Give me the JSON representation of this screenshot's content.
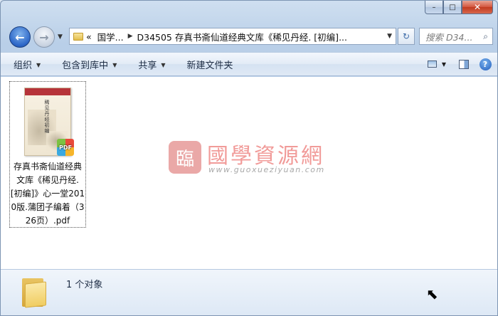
{
  "window": {
    "caption": {
      "minimize": "–",
      "maximize": "□",
      "close": "✕"
    }
  },
  "nav": {
    "back_icon": "←",
    "forward_icon": "→",
    "dropdown_icon": "▼"
  },
  "address": {
    "overflow": "«",
    "crumb1": "国学...",
    "separator": "▶",
    "crumb2": "D34505 存真书斋仙道经典文库《稀见丹经. [初编]...",
    "dropdown_icon": "▼"
  },
  "refresh_icon": "↻",
  "search": {
    "placeholder": "搜索 D34...",
    "icon": "⌕"
  },
  "toolbar": {
    "organize": "组织",
    "include_library": "包含到库中",
    "share": "共享",
    "new_folder": "新建文件夹",
    "dropdown_icon": "▼",
    "help_icon": "?"
  },
  "file": {
    "name": "存真书斋仙道经典文库《稀见丹经. [初编]》心一堂2010版.蒲团子编着（326页）.pdf",
    "thumb_title": "稀见丹经初编",
    "badge": "PDF"
  },
  "watermark": {
    "seal": "臨",
    "title": "國學資源網",
    "url": "www.guoxueziyuan.com"
  },
  "status": {
    "count": "1 个对象"
  },
  "colors": {
    "accent": "#2c66c7",
    "close": "#c13a1f",
    "watermark": "#ef8a88"
  }
}
